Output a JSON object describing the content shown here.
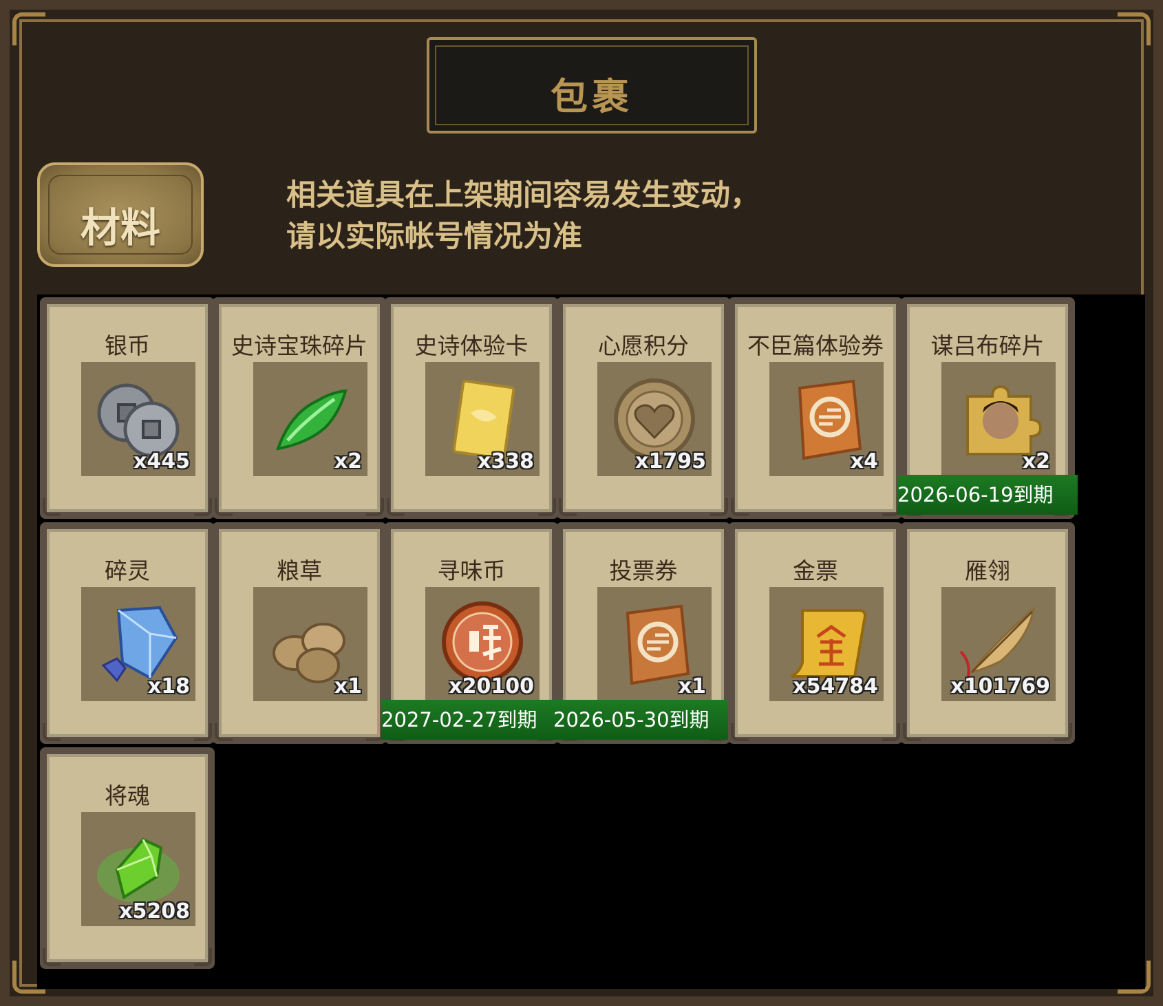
{
  "window": {
    "title": "包裹"
  },
  "category_tab": {
    "label": "材料"
  },
  "notice": {
    "line1": "相关道具在上架期间容易发生变动，",
    "line2": "请以实际帐号情况为准"
  },
  "items": [
    {
      "name": "银币",
      "qty": "x445",
      "icon": "coins-icon",
      "expire": ""
    },
    {
      "name": "史诗宝珠碎片",
      "qty": "x2",
      "icon": "green-gem-shard-icon",
      "expire": ""
    },
    {
      "name": "史诗体验卡",
      "qty": "x338",
      "icon": "gold-card-icon",
      "expire": ""
    },
    {
      "name": "心愿积分",
      "qty": "x1795",
      "icon": "heart-coin-icon",
      "expire": ""
    },
    {
      "name": "不臣篇体验券",
      "qty": "x4",
      "icon": "voucher-icon",
      "expire": ""
    },
    {
      "name": "谋吕布碎片",
      "qty": "x2",
      "icon": "hero-puzzle-icon",
      "expire": "2026-06-19到期"
    },
    {
      "name": "碎灵",
      "qty": "x18",
      "icon": "crystal-shard-icon",
      "expire": ""
    },
    {
      "name": "粮草",
      "qty": "x1",
      "icon": "grain-bundle-icon",
      "expire": ""
    },
    {
      "name": "寻味币",
      "qty": "x20100",
      "icon": "flavor-coin-icon",
      "expire": "2027-02-27到期"
    },
    {
      "name": "投票券",
      "qty": "x1",
      "icon": "ballot-ticket-icon",
      "expire": "2026-05-30到期"
    },
    {
      "name": "金票",
      "qty": "x54784",
      "icon": "gold-scroll-icon",
      "expire": ""
    },
    {
      "name": "雁翎",
      "qty": "x101769",
      "icon": "feather-icon",
      "expire": ""
    },
    {
      "name": "将魂",
      "qty": "x5208",
      "icon": "soul-crystal-icon",
      "expire": ""
    }
  ],
  "colors": {
    "frame": "#4a3a2b",
    "gold_text": "#b99554",
    "card_bg": "#cbbd98",
    "expire_bar": "#1d7a22"
  }
}
